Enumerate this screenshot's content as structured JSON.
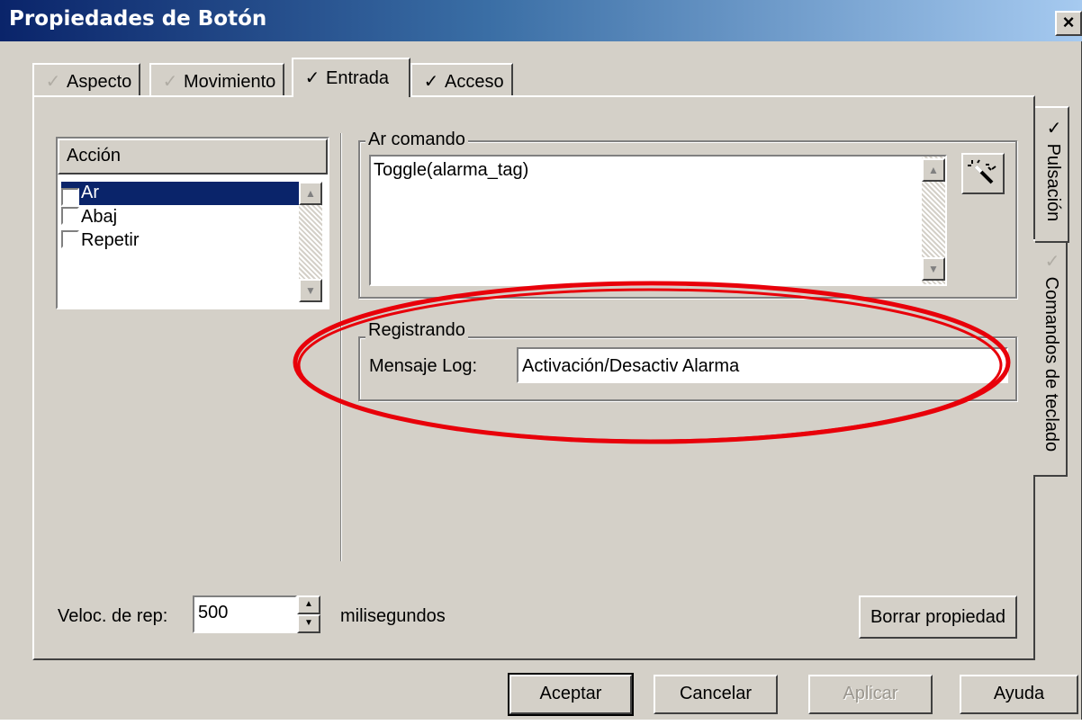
{
  "window": {
    "title": "Propiedades de Botón",
    "close_glyph": "×"
  },
  "tabs": [
    {
      "label": "Aspecto",
      "checked": false
    },
    {
      "label": "Movimiento",
      "checked": false
    },
    {
      "label": "Entrada",
      "checked": true
    },
    {
      "label": "Acceso",
      "checked": true
    }
  ],
  "side_tabs": [
    {
      "label": "Pulsación",
      "checked": true
    },
    {
      "label": "Comandos de teclado",
      "checked": false
    }
  ],
  "accion": {
    "header": "Acción",
    "items": [
      {
        "label": "Ar",
        "checked": true,
        "selected": true
      },
      {
        "label": "Abaj",
        "checked": false,
        "selected": false
      },
      {
        "label": "Repetir",
        "checked": false,
        "selected": false
      }
    ]
  },
  "command": {
    "group_label": "Ar comando",
    "text": "Toggle(alarma_tag)",
    "wizard_icon": "magic-wand-icon"
  },
  "logging": {
    "group_label": "Registrando",
    "field_label": "Mensaje Log:",
    "value": "Activación/Desactiv Alarma"
  },
  "repeat": {
    "label": "Veloc. de rep:",
    "value": "500",
    "unit": "milisegundos"
  },
  "buttons": {
    "clear": "Borrar propiedad",
    "ok": "Aceptar",
    "cancel": "Cancelar",
    "apply": "Aplicar",
    "help": "Ayuda"
  },
  "annotation": {
    "color": "#e8000a"
  }
}
